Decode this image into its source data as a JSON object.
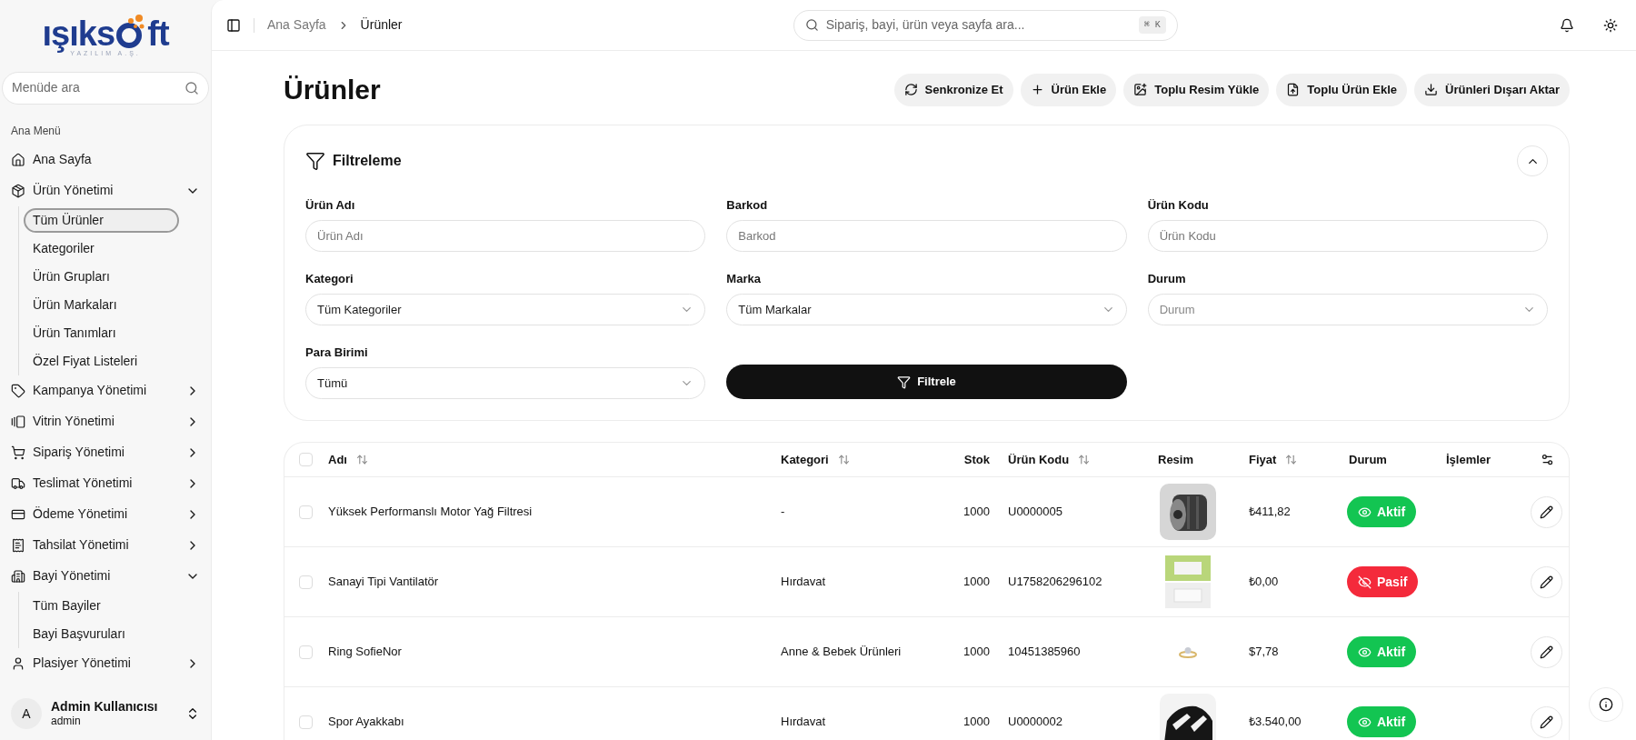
{
  "logo": {
    "wordmark_start": "ışıks",
    "wordmark_end": "ft",
    "tagline": "YAZILIM A.Ş."
  },
  "sidebar": {
    "search": {
      "placeholder": "Menüde ara"
    },
    "section": "Ana Menü",
    "items": [
      {
        "label": "Ana Sayfa",
        "kind": "link"
      },
      {
        "label": "Ürün Yönetimi",
        "kind": "group",
        "expanded": true,
        "children": [
          {
            "label": "Tüm Ürünler",
            "selected": true
          },
          {
            "label": "Kategoriler",
            "selected": false
          },
          {
            "label": "Ürün Grupları",
            "selected": false
          },
          {
            "label": "Ürün Markaları",
            "selected": false
          },
          {
            "label": "Ürün Tanımları",
            "selected": false
          },
          {
            "label": "Özel Fiyat Listeleri",
            "selected": false
          }
        ]
      },
      {
        "label": "Kampanya Yönetimi",
        "kind": "group",
        "expanded": false
      },
      {
        "label": "Vitrin Yönetimi",
        "kind": "group",
        "expanded": false
      },
      {
        "label": "Sipariş Yönetimi",
        "kind": "group",
        "expanded": false
      },
      {
        "label": "Teslimat Yönetimi",
        "kind": "group",
        "expanded": false
      },
      {
        "label": "Ödeme Yönetimi",
        "kind": "group",
        "expanded": false
      },
      {
        "label": "Tahsilat Yönetimi",
        "kind": "group",
        "expanded": false
      },
      {
        "label": "Bayi Yönetimi",
        "kind": "group",
        "expanded": true,
        "children": [
          {
            "label": "Tüm Bayiler",
            "selected": false
          },
          {
            "label": "Bayi Başvuruları",
            "selected": false
          }
        ]
      },
      {
        "label": "Plasiyer Yönetimi",
        "kind": "group",
        "expanded": false
      }
    ],
    "user": {
      "initial": "A",
      "name": "Admin Kullanıcısı",
      "role": "admin"
    }
  },
  "header": {
    "breadcrumb": [
      "Ana Sayfa",
      "Ürünler"
    ],
    "search": {
      "placeholder": "Sipariş, bayi, ürün veya sayfa ara...",
      "shortcut": "⌘ K"
    }
  },
  "page": {
    "title": "Ürünler",
    "actions": [
      "Senkronize Et",
      "Ürün Ekle",
      "Toplu Resim Yükle",
      "Toplu Ürün Ekle",
      "Ürünleri Dışarı Aktar"
    ]
  },
  "filter": {
    "title": "Filtreleme",
    "expanded": true,
    "submit": "Filtrele",
    "fields": [
      {
        "label": "Ürün Adı",
        "kind": "text",
        "placeholder": "Ürün Adı"
      },
      {
        "label": "Barkod",
        "kind": "text",
        "placeholder": "Barkod"
      },
      {
        "label": "Ürün Kodu",
        "kind": "text",
        "placeholder": "Ürün Kodu"
      },
      {
        "label": "Kategori",
        "kind": "select",
        "value": "Tüm Kategoriler"
      },
      {
        "label": "Marka",
        "kind": "select",
        "value": "Tüm Markalar"
      },
      {
        "label": "Durum",
        "kind": "select",
        "placeholder": "Durum"
      },
      {
        "label": "Para Birimi",
        "kind": "select",
        "value": "Tümü"
      }
    ]
  },
  "table": {
    "select_all": {
      "checked": false
    },
    "columns": [
      {
        "label": "Adı",
        "sortable": true
      },
      {
        "label": "Kategori",
        "sortable": true
      },
      {
        "label": "Stok",
        "sortable": false
      },
      {
        "label": "Ürün Kodu",
        "sortable": true
      },
      {
        "label": "Resim",
        "sortable": false
      },
      {
        "label": "Fiyat",
        "sortable": true
      },
      {
        "label": "Durum",
        "sortable": false
      },
      {
        "label": "İşlemler",
        "sortable": false
      }
    ],
    "rows": [
      {
        "checked": false,
        "name": "Yüksek Performanslı Motor Yağ Filtresi",
        "category": "-",
        "stock": "1000",
        "code": "U0000005",
        "price": "₺411,82",
        "status": {
          "label": "Aktif",
          "active": true
        }
      },
      {
        "checked": false,
        "name": "Sanayi Tipi Vantilatör",
        "category": "Hırdavat",
        "stock": "1000",
        "code": "U1758206296102",
        "price": "₺0,00",
        "status": {
          "label": "Pasif",
          "active": false
        }
      },
      {
        "checked": false,
        "name": "Ring SofieNor",
        "category": "Anne & Bebek Ürünleri",
        "stock": "1000",
        "code": "10451385960",
        "price": "$7,78",
        "status": {
          "label": "Aktif",
          "active": true
        }
      },
      {
        "checked": false,
        "name": "Spor Ayakkabı",
        "category": "Hırdavat",
        "stock": "1000",
        "code": "U0000002",
        "price": "₺3.540,00",
        "status": {
          "label": "Aktif",
          "active": true
        }
      }
    ]
  }
}
